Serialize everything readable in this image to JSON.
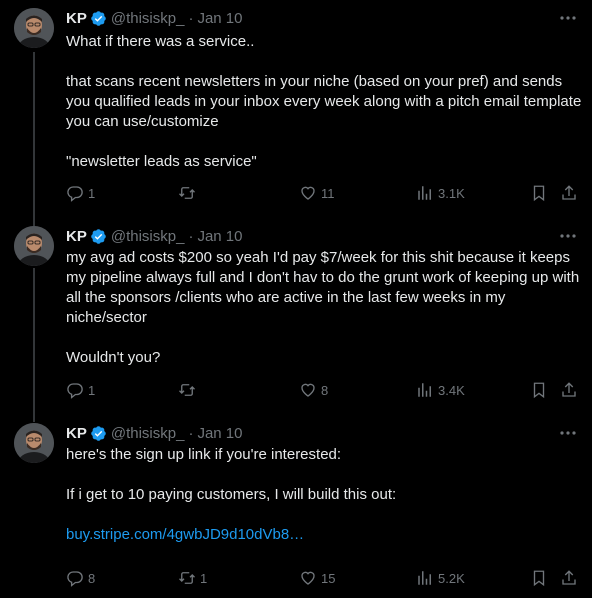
{
  "author": {
    "name": "KP",
    "handle": "@thisiskp_",
    "separator": "·"
  },
  "colors": {
    "background": "#000000",
    "text": "#e7e9ea",
    "muted": "#71767b",
    "link": "#1d9bf0",
    "verified": "#1d9bf0"
  },
  "tweets": [
    {
      "date": "Jan 10",
      "paragraphs": [
        "What if there was a service..",
        "",
        "that scans recent newsletters in your niche (based on your pref) and sends you qualified leads in your inbox every week along with a pitch email template you can use/customize",
        "",
        "\"newsletter leads as service\""
      ],
      "replies": "1",
      "reposts": "",
      "likes": "11",
      "views": "3.1K"
    },
    {
      "date": "Jan 10",
      "paragraphs": [
        "my avg ad costs $200 so yeah I'd pay $7/week for this shit because it keeps my pipeline always full and I don't hav to do the grunt work of keeping up with all the sponsors /clients who are active in the last few weeks in my niche/sector",
        "",
        "Wouldn't you?"
      ],
      "replies": "1",
      "reposts": "",
      "likes": "8",
      "views": "3.4K"
    },
    {
      "date": "Jan 10",
      "paragraphs": [
        "here's the sign up link if you're interested:",
        "",
        "If i get to 10 paying customers, I will build this out:",
        ""
      ],
      "link": "buy.stripe.com/4gwbJD9d10dVb8…",
      "replies": "8",
      "reposts": "1",
      "likes": "15",
      "views": "5.2K"
    }
  ]
}
